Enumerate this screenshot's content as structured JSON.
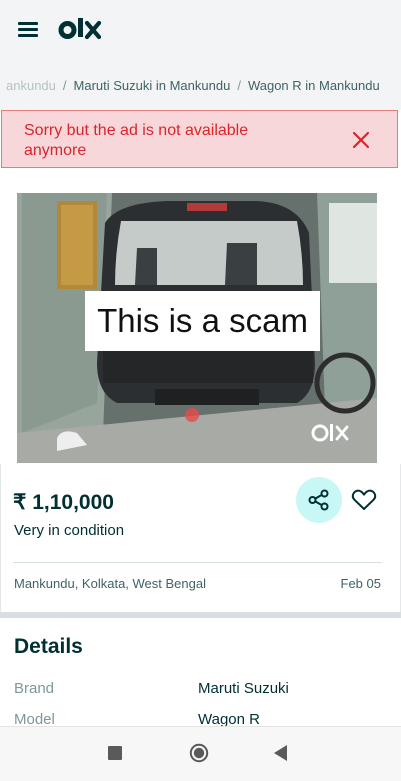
{
  "header": {
    "logo_text": "olx",
    "menu_icon": "hamburger-menu-icon"
  },
  "breadcrumb": {
    "items": [
      "ankundu",
      "Maruti Suzuki in Mankundu",
      "Wagon R in Mankundu"
    ],
    "separator": "/"
  },
  "alert": {
    "message": "Sorry but the ad is not available anymore",
    "close_icon": "close-icon",
    "color": "#d9252b"
  },
  "photo": {
    "overlay_text": "This is a scam",
    "watermark": "olx"
  },
  "listing": {
    "price": "₹ 1,10,000",
    "subtitle": "Very in condition",
    "location": "Mankundu, Kolkata, West Bengal",
    "date": "Feb 05",
    "share_icon": "share-icon",
    "favorite_icon": "heart-icon"
  },
  "details": {
    "title": "Details",
    "rows": [
      {
        "label": "Brand",
        "value": "Maruti Suzuki"
      },
      {
        "label": "Model",
        "value": "Wagon R"
      }
    ]
  },
  "navbar": {
    "recent_icon": "square-recents-icon",
    "home_icon": "circle-home-icon",
    "back_icon": "triangle-back-icon"
  }
}
